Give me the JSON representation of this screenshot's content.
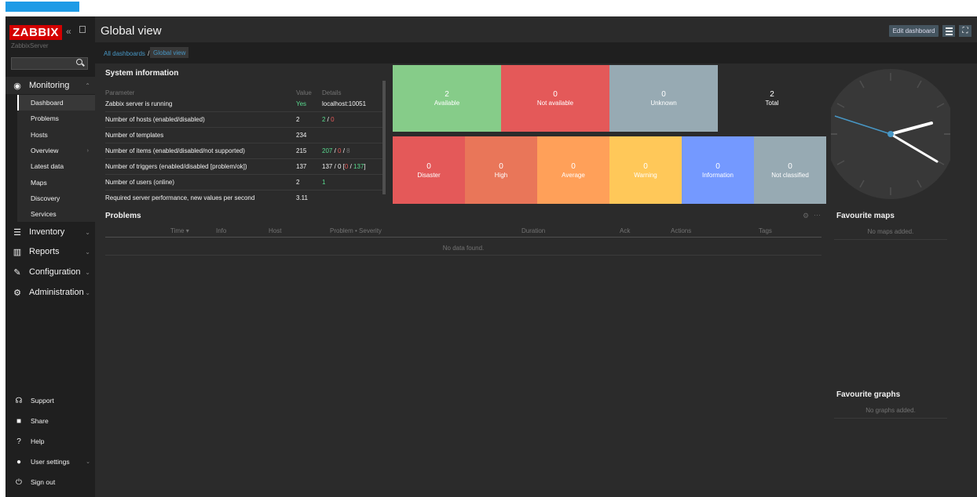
{
  "app": {
    "logo": "ZABBIX",
    "server_name": "ZabbixServer",
    "search": {
      "placeholder": "",
      "value": ""
    }
  },
  "sidebar": {
    "monitoring": {
      "label": "Monitoring",
      "items": [
        "Dashboard",
        "Problems",
        "Hosts",
        "Overview",
        "Latest data",
        "Maps",
        "Discovery",
        "Services"
      ]
    },
    "inventory": "Inventory",
    "reports": "Reports",
    "configuration": "Configuration",
    "administration": "Administration",
    "support": "Support",
    "share": "Share",
    "help": "Help",
    "user_settings": "User settings",
    "sign_out": "Sign out"
  },
  "header": {
    "title": "Global view",
    "edit_button": "Edit dashboard"
  },
  "breadcrumb": {
    "root": "All dashboards",
    "separator": "/",
    "current": "Global view"
  },
  "system_info": {
    "title": "System information",
    "columns": [
      "Parameter",
      "Value",
      "Details"
    ],
    "rows": [
      {
        "param": "Zabbix server is running",
        "value": "Yes",
        "details": [
          "localhost:10051"
        ]
      },
      {
        "param": "Number of hosts (enabled/disabled)",
        "value": "2",
        "details": [
          "2",
          " / ",
          "0"
        ]
      },
      {
        "param": "Number of templates",
        "value": "234",
        "details": []
      },
      {
        "param": "Number of items (enabled/disabled/not supported)",
        "value": "215",
        "details": [
          "207",
          " / ",
          "0",
          " / ",
          "8"
        ]
      },
      {
        "param": "Number of triggers (enabled/disabled [problem/ok])",
        "value": "137",
        "details": [
          "137 / 0 [",
          "0",
          " / ",
          "137",
          "]"
        ]
      },
      {
        "param": "Number of users (online)",
        "value": "2",
        "details": [
          "1"
        ]
      },
      {
        "param": "Required server performance, new values per second",
        "value": "3.11",
        "details": []
      }
    ]
  },
  "host_availability": [
    {
      "count": "2",
      "label": "Available",
      "color": "#86cc89"
    },
    {
      "count": "0",
      "label": "Not available",
      "color": "#e45959"
    },
    {
      "count": "0",
      "label": "Unknown",
      "color": "#97aab3"
    },
    {
      "count": "2",
      "label": "Total",
      "color": "#2b2b2b"
    }
  ],
  "problem_severity": [
    {
      "count": "0",
      "label": "Disaster",
      "color": "#e45959"
    },
    {
      "count": "0",
      "label": "High",
      "color": "#e97659"
    },
    {
      "count": "0",
      "label": "Average",
      "color": "#ffa059"
    },
    {
      "count": "0",
      "label": "Warning",
      "color": "#ffc859"
    },
    {
      "count": "0",
      "label": "Information",
      "color": "#7499ff"
    },
    {
      "count": "0",
      "label": "Not classified",
      "color": "#97aab3"
    }
  ],
  "problems": {
    "title": "Problems",
    "columns": [
      "Time ▾",
      "Info",
      "Host",
      "Problem • Severity",
      "Duration",
      "Ack",
      "Actions",
      "Tags"
    ],
    "empty_text": "No data found."
  },
  "favourite_maps": {
    "title": "Favourite maps",
    "empty_text": "No maps added."
  },
  "favourite_graphs": {
    "title": "Favourite graphs",
    "empty_text": "No graphs added."
  }
}
